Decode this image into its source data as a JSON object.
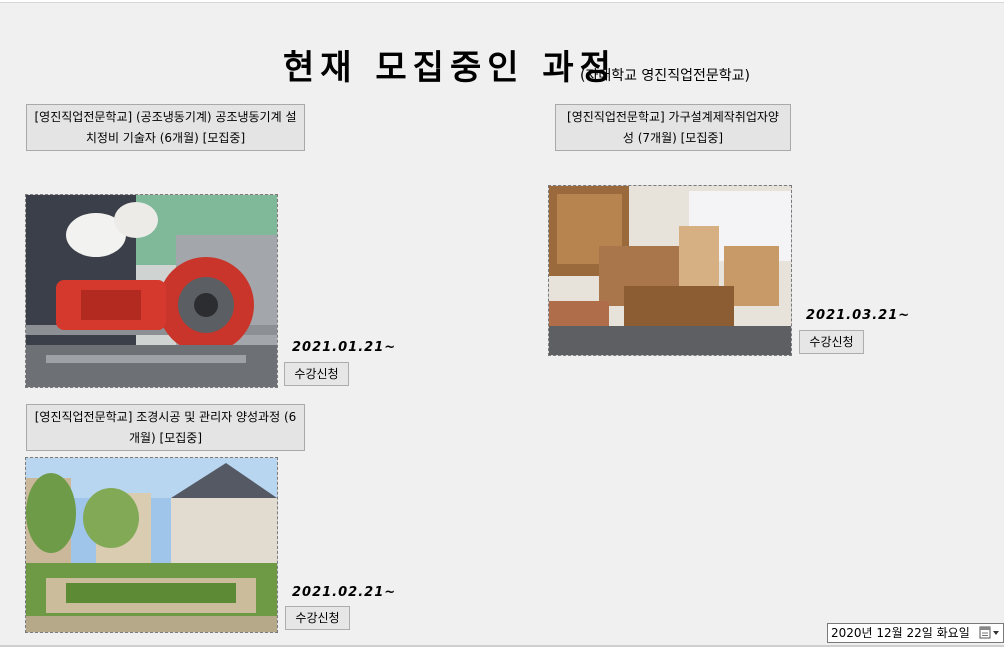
{
  "header": {
    "title": "현재 모집중인 과정",
    "subtitle": "(자매학교 영진직업전문학교)"
  },
  "courses": [
    {
      "label": "[영진직업전문학교] (공조냉동기계) 공조냉동기계 설치정비 기술자 (6개월) [모집중]",
      "date": "2021.01.21~",
      "button": "수강신청"
    },
    {
      "label": "[영진직업전문학교] 가구설계제작취업자양성 (7개월) [모집중]",
      "date": "2021.03.21~",
      "button": "수강신청"
    },
    {
      "label": "[영진직업전문학교] 조경시공 및 관리자 양성과정 (6개월) [모집중]",
      "date": "2021.02.21~",
      "button": "수강신청"
    }
  ],
  "date_picker": {
    "value": "2020년 12월 22일 화요일",
    "icon": "calendar-dropdown-icon"
  }
}
